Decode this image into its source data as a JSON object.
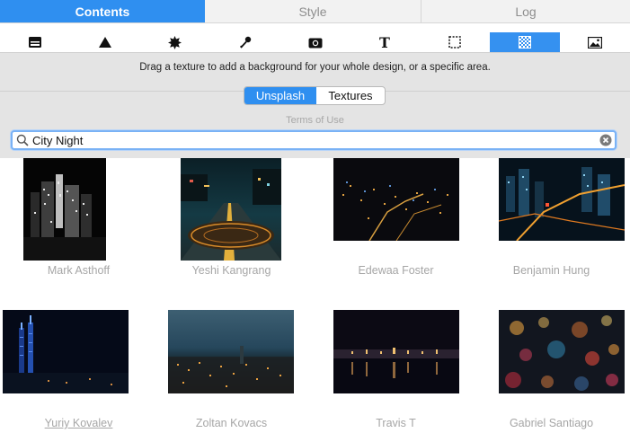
{
  "tabs": [
    {
      "label": "Contents",
      "active": true
    },
    {
      "label": "Style",
      "active": false
    },
    {
      "label": "Log",
      "active": false
    }
  ],
  "toolbar": {
    "icons": [
      "layers-icon",
      "triangle-icon",
      "starburst-icon",
      "brush-icon",
      "camera-icon",
      "text-icon",
      "selection-icon",
      "texture-icon",
      "image-icon"
    ],
    "active_icon": "texture-icon"
  },
  "hint": "Drag a texture to add a background for your whole design, or a specific area.",
  "source_switch": {
    "options": [
      "Unsplash",
      "Textures"
    ],
    "selected": "Unsplash"
  },
  "terms_link": "Terms of Use",
  "search": {
    "value": "City Night",
    "placeholder": ""
  },
  "photos": [
    {
      "author": "Mark Asthoff"
    },
    {
      "author": "Yeshi Kangrang"
    },
    {
      "author": "Edewaa Foster"
    },
    {
      "author": "Benjamin Hung"
    },
    {
      "author": "Yuriy Kovalev"
    },
    {
      "author": "Zoltan Kovacs"
    },
    {
      "author": "Travis T"
    },
    {
      "author": "Gabriel Santiago"
    }
  ],
  "colors": {
    "accent": "#2f8ff0",
    "hint_bg": "#e4e4e4",
    "caption": "#a6a6a6"
  }
}
